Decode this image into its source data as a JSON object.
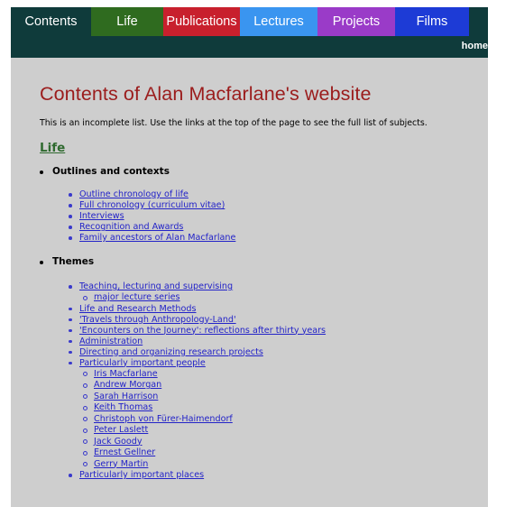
{
  "nav": {
    "tabs": [
      {
        "label": "Contents",
        "color": "#0f3b3b"
      },
      {
        "label": "Life",
        "color": "#2f6b1f"
      },
      {
        "label": "Publications",
        "color": "#c8202d"
      },
      {
        "label": "Lectures",
        "color": "#3a95f0"
      },
      {
        "label": "Projects",
        "color": "#9a3bc8"
      },
      {
        "label": "Films",
        "color": "#1d3bd6"
      }
    ],
    "home": "home"
  },
  "page": {
    "title": "Contents of Alan Macfarlane's website",
    "intro": "This is an incomplete list. Use the links at the top of the page to see the full list of subjects.",
    "section": "Life",
    "outlines": {
      "heading": "Outlines and contexts",
      "items": [
        "Outline chronology of life",
        "Full chronology (curriculum vitae)",
        "Interviews",
        "Recognition and Awards",
        "Family ancestors of Alan Macfarlane"
      ]
    },
    "themes": {
      "heading": "Themes",
      "teaching": "Teaching, lecturing and supervising",
      "teaching_sub": "major lecture series",
      "items": [
        "Life and Research Methods",
        "'Travels through Anthropology-Land'",
        "'Encounters on the Journey': reflections after thirty years",
        "Administration",
        "Directing and organizing research projects"
      ],
      "people": "Particularly important people",
      "people_list": [
        "Iris Macfarlane",
        "Andrew Morgan",
        "Sarah Harrison",
        "Keith Thomas",
        "Christoph von Fürer-Haimendorf",
        "Peter Laslett",
        "Jack Goody",
        "Ernest Gellner",
        "Gerry Martin"
      ],
      "places": "Particularly important places"
    }
  }
}
